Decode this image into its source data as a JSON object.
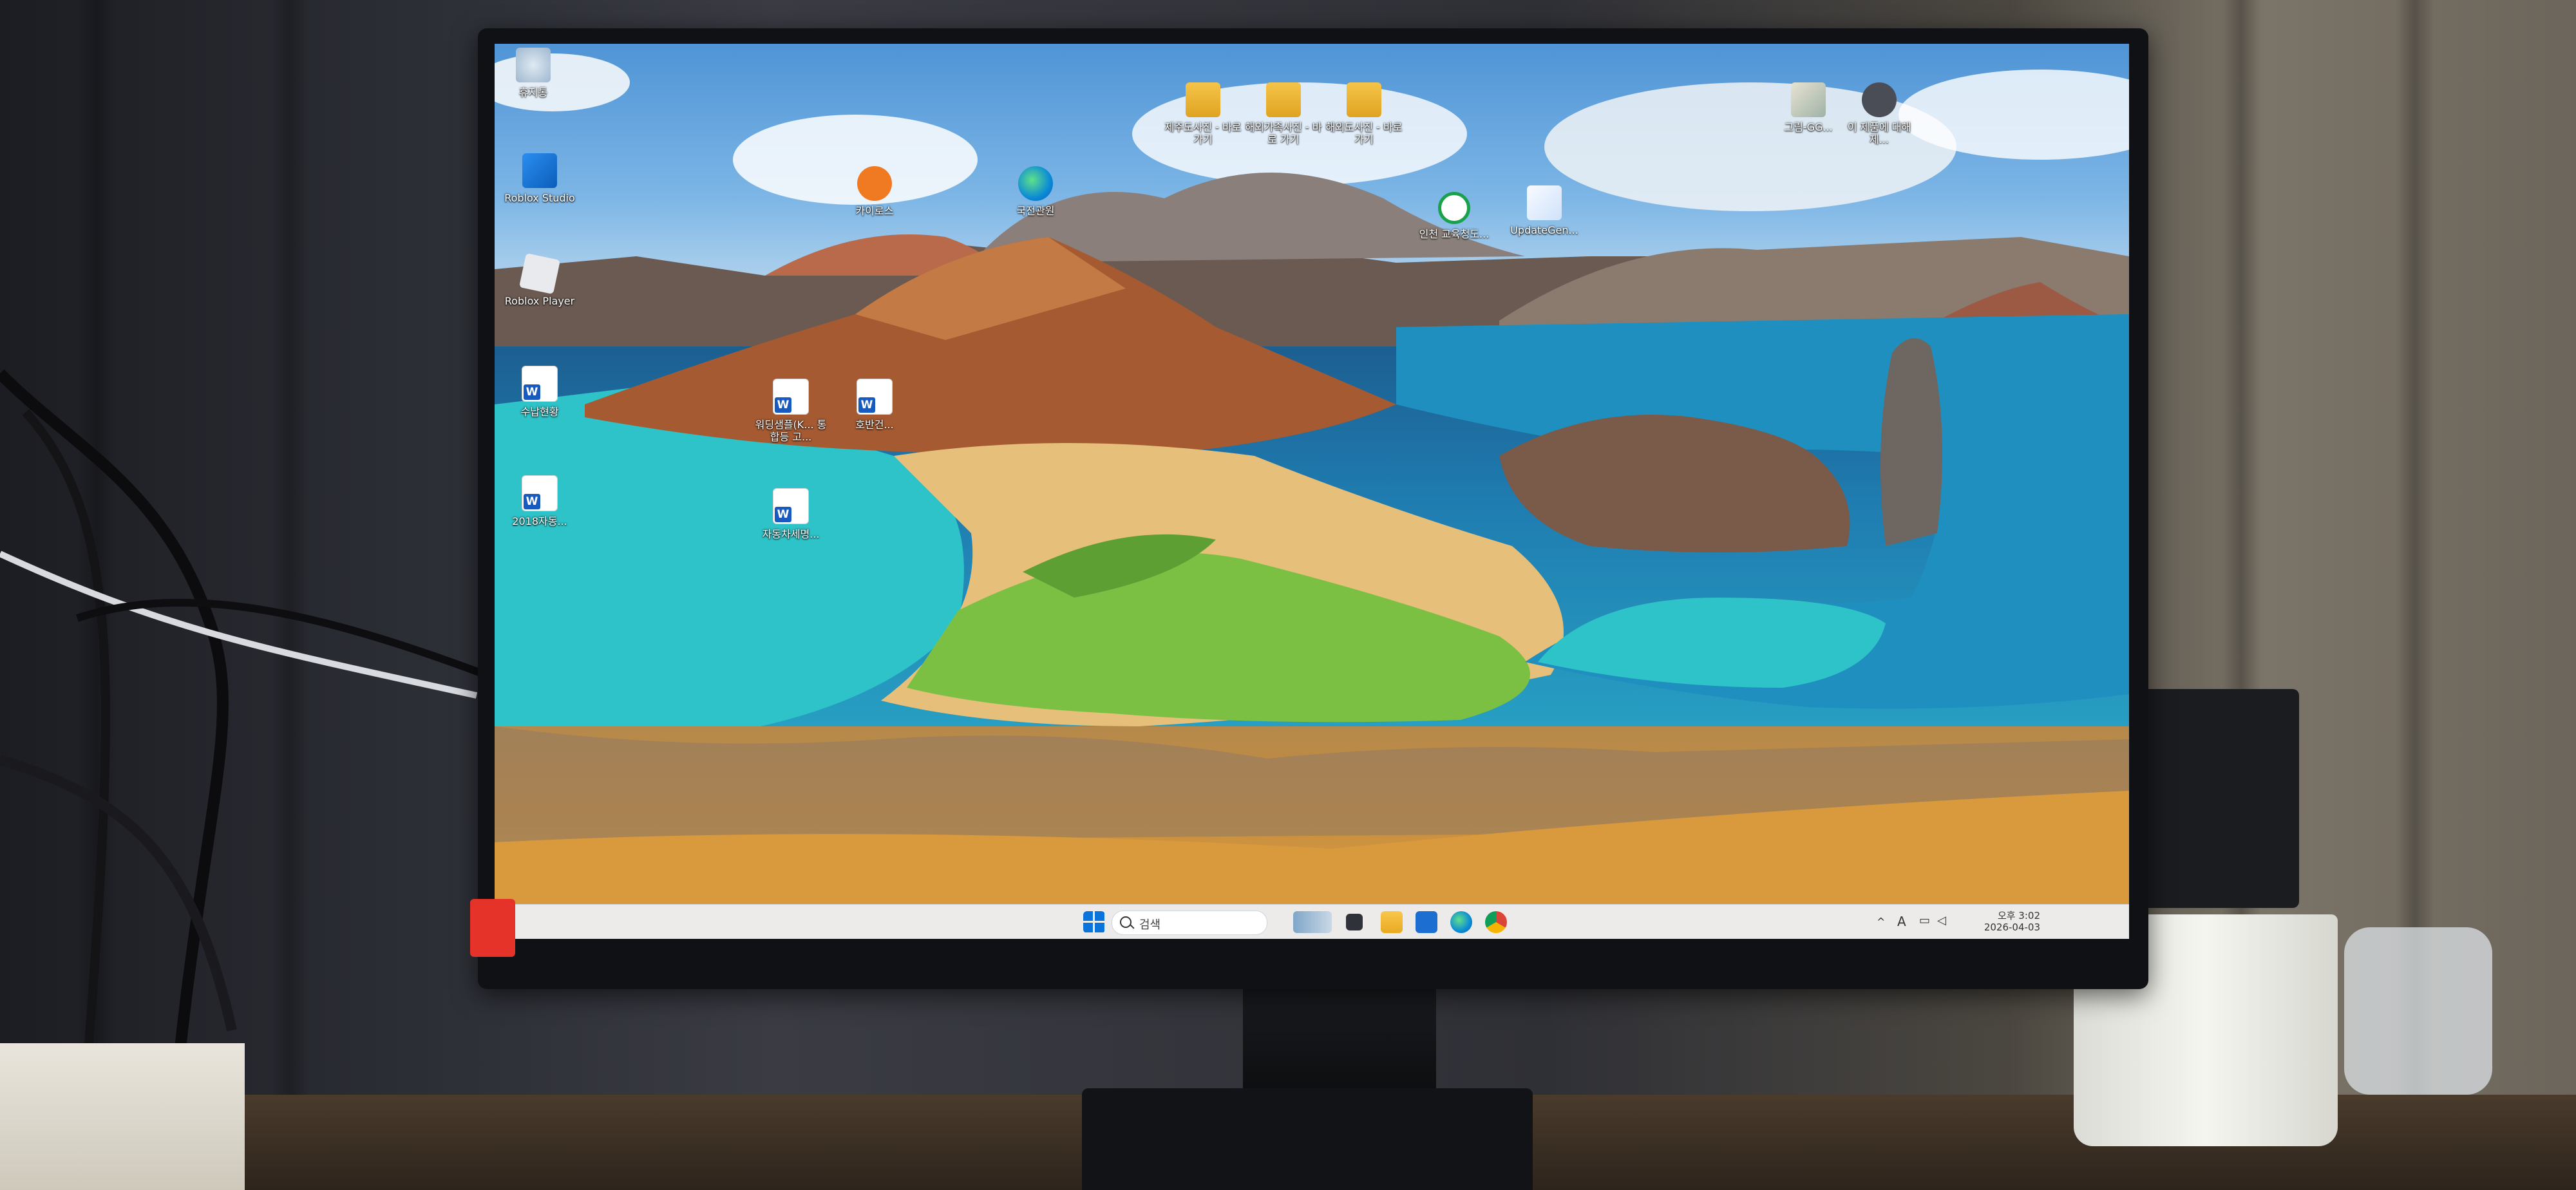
{
  "desktop_icons": [
    {
      "name": "recycle-bin",
      "label": "휴지통",
      "type": "recycle"
    },
    {
      "name": "roblox-studio",
      "label": "Roblox Studio",
      "type": "roblox-studio"
    },
    {
      "name": "roblox-player",
      "label": "Roblox Player",
      "type": "roblox-player"
    },
    {
      "name": "word-doc-1",
      "label": "수납현황",
      "type": "word"
    },
    {
      "name": "word-doc-2",
      "label": "2018자동...",
      "type": "word"
    },
    {
      "name": "kairos",
      "label": "카이로스",
      "type": "app"
    },
    {
      "name": "edge",
      "label": "국전관원",
      "type": "edge"
    },
    {
      "name": "word-doc-3",
      "label": "워딩샘플(K... 통합등 고...",
      "type": "word"
    },
    {
      "name": "word-doc-4",
      "label": "호반건...",
      "type": "word"
    },
    {
      "name": "word-doc-5",
      "label": "자동차세명...",
      "type": "word"
    },
    {
      "name": "folder-1",
      "label": "제주도사진 - 바로 가기",
      "type": "folder"
    },
    {
      "name": "folder-2",
      "label": "해외가족사진 - 바로 가기",
      "type": "folder"
    },
    {
      "name": "folder-3",
      "label": "해외도사진 - 바로 가기",
      "type": "folder"
    },
    {
      "name": "green-app",
      "label": "인천 교육청도...",
      "type": "app"
    },
    {
      "name": "update-gen",
      "label": "UpdateGen...",
      "type": "app"
    },
    {
      "name": "image-file",
      "label": "그림-GG...",
      "type": "image"
    },
    {
      "name": "pc-shortcut",
      "label": "이 제품에 대해 제...",
      "type": "app"
    }
  ],
  "taskbar": {
    "search_placeholder": "검색",
    "pinned_apps": [
      "windows-start",
      "search",
      "widgets",
      "task-view",
      "file-explorer",
      "microsoft-store",
      "edge",
      "chrome"
    ],
    "tray": {
      "time": "오후 3:02",
      "date": "2026-04-03"
    }
  },
  "colors": {
    "taskbar_bg": "#eef1f6",
    "sea": "#1f7cb0",
    "lagoon": "#2ec3c8",
    "sand": "#d8a24a",
    "vegetation": "#7bc043",
    "volcano": "#a55a32"
  }
}
